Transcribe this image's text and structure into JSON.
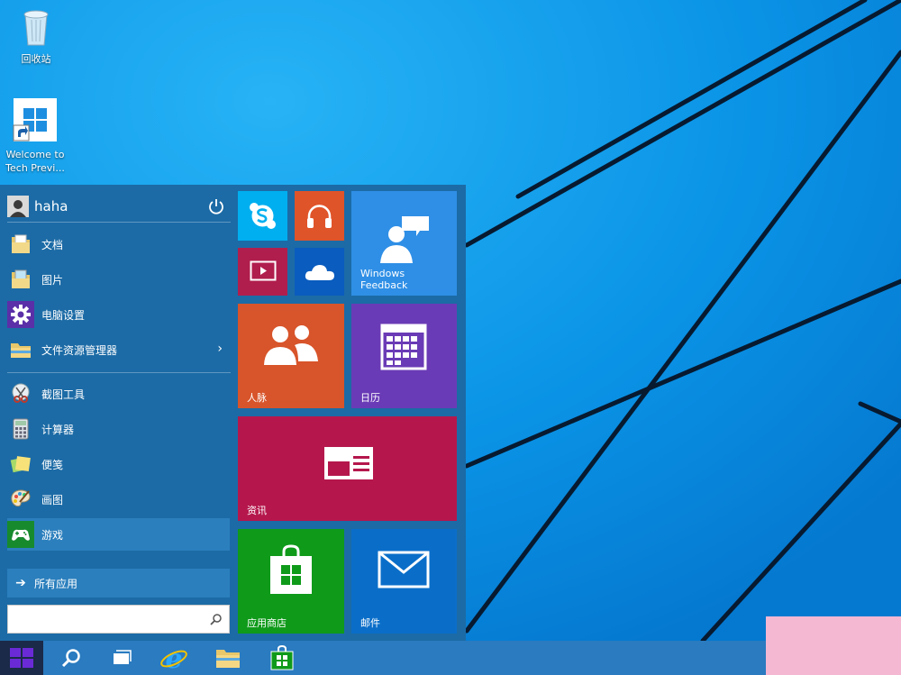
{
  "desktop": {
    "icons": [
      {
        "label": "回收站"
      },
      {
        "label": "Welcome to Tech Previ..."
      }
    ]
  },
  "start_menu": {
    "user": {
      "name": "haha"
    },
    "items": [
      {
        "label": "文档",
        "icon": "documents-folder-icon"
      },
      {
        "label": "图片",
        "icon": "pictures-folder-icon"
      },
      {
        "label": "电脑设置",
        "icon": "gear-icon"
      },
      {
        "label": "文件资源管理器",
        "icon": "file-explorer-icon",
        "has_submenu": true
      },
      {
        "label": "截图工具",
        "icon": "snipping-tool-icon"
      },
      {
        "label": "计算器",
        "icon": "calculator-icon"
      },
      {
        "label": "便笺",
        "icon": "sticky-notes-icon"
      },
      {
        "label": "画图",
        "icon": "paint-palette-icon"
      },
      {
        "label": "游戏",
        "icon": "gamepad-icon",
        "selected": true
      }
    ],
    "chevron": "›",
    "all_apps": {
      "label": "所有应用",
      "arrow": "➔"
    },
    "search": {
      "placeholder": "",
      "value": ""
    }
  },
  "tiles": [
    {
      "name": "skype",
      "label": "",
      "color": "#00aff0"
    },
    {
      "name": "music",
      "label": "",
      "color": "#e0542a"
    },
    {
      "name": "video",
      "label": "",
      "color": "#b01e4e"
    },
    {
      "name": "onedrive",
      "label": "",
      "color": "#0a5cbf"
    },
    {
      "name": "windows-feedback",
      "label": "Windows Feedback",
      "color": "#2f8fe6"
    },
    {
      "name": "people",
      "label": "人脉",
      "color": "#d8542a"
    },
    {
      "name": "calendar",
      "label": "日历",
      "color": "#6a3bb6"
    },
    {
      "name": "news",
      "label": "资讯",
      "color": "#b5174c"
    },
    {
      "name": "store",
      "label": "应用商店",
      "color": "#0f9a1a"
    },
    {
      "name": "mail",
      "label": "邮件",
      "color": "#0a6ec9"
    }
  ],
  "taskbar": {
    "buttons": [
      "start-button",
      "search-button",
      "task-view-button",
      "internet-explorer-button",
      "file-explorer-button",
      "store-button"
    ]
  },
  "colors": {
    "wallpaper": "#0a8ce0",
    "start_menu_bg": "#1c6ba6",
    "taskbar": "#2a7bc0"
  }
}
